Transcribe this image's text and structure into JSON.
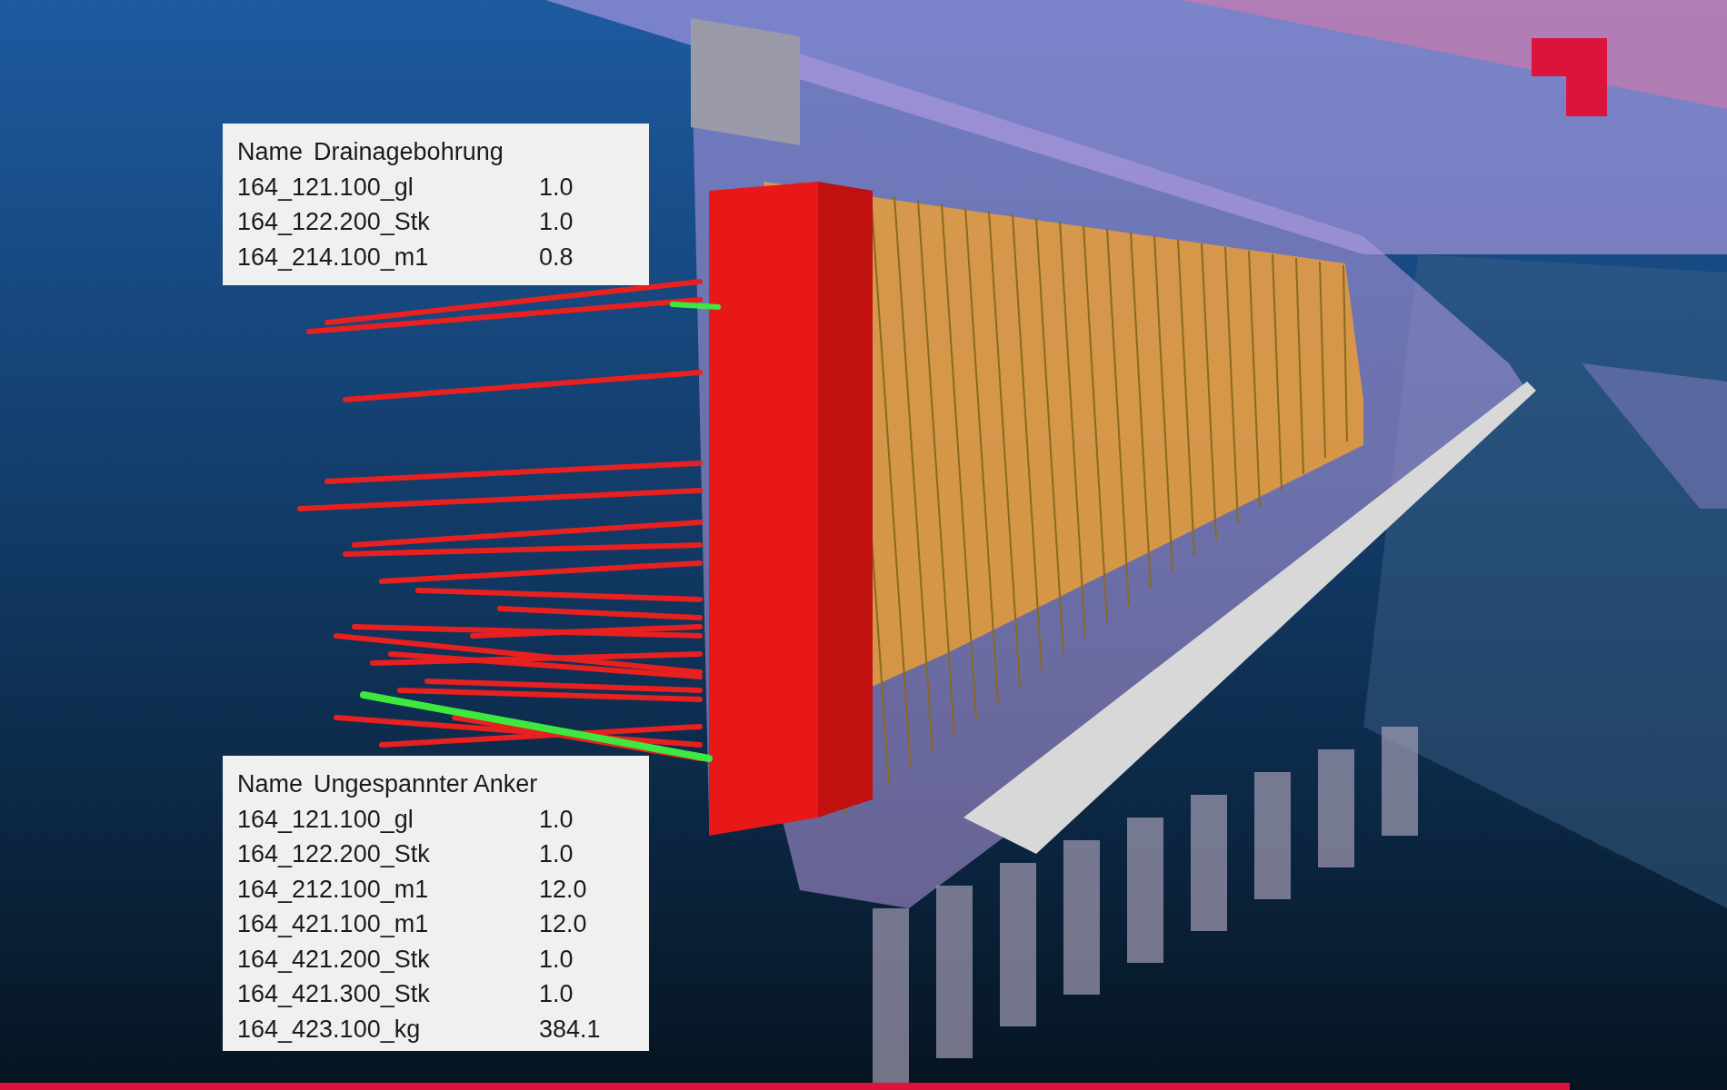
{
  "panels": [
    {
      "label": "Name",
      "title": "Drainagebohrung",
      "rows": [
        {
          "name": "164_121.100_gl",
          "value": "1.0"
        },
        {
          "name": "164_122.200_Stk",
          "value": "1.0"
        },
        {
          "name": "164_214.100_m1",
          "value": "0.8"
        }
      ]
    },
    {
      "label": "Name",
      "title": "Ungespannter Anker",
      "rows": [
        {
          "name": "164_121.100_gl",
          "value": "1.0"
        },
        {
          "name": "164_122.200_Stk",
          "value": "1.0"
        },
        {
          "name": "164_212.100_m1",
          "value": "12.0"
        },
        {
          "name": "164_421.100_m1",
          "value": "12.0"
        },
        {
          "name": "164_421.200_Stk",
          "value": "1.0"
        },
        {
          "name": "164_421.300_Stk",
          "value": "1.0"
        },
        {
          "name": "164_423.100_kg",
          "value": "384.1"
        }
      ]
    }
  ]
}
